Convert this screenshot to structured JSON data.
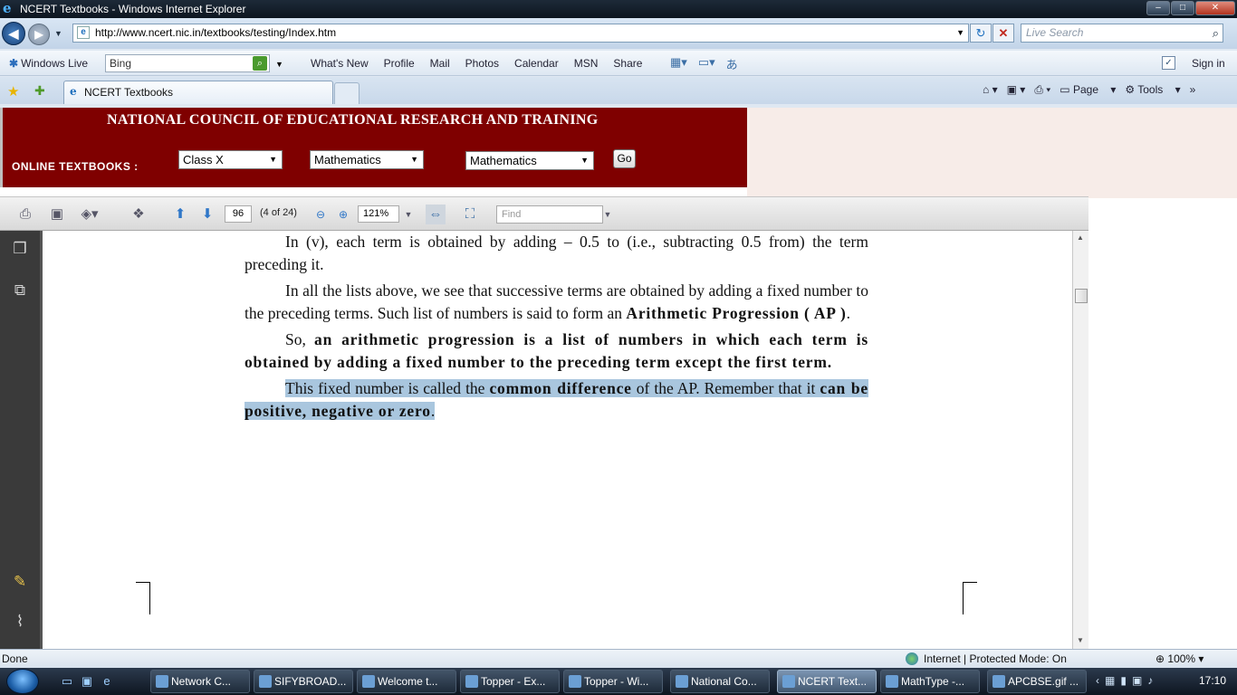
{
  "window": {
    "title": "NCERT Textbooks - Windows Internet Explorer",
    "min": "‒",
    "max": "□",
    "close": "✕"
  },
  "addressbar": {
    "url": "http://www.ncert.nic.in/textbooks/testing/Index.htm",
    "live_search_placeholder": "Live Search"
  },
  "live_toolbar": {
    "brand": "Windows Live",
    "search_value": "Bing",
    "links": [
      "What's New",
      "Profile",
      "Mail",
      "Photos",
      "Calendar",
      "MSN",
      "Share"
    ],
    "sign_in": "Sign in"
  },
  "tabs": {
    "active_tab": "NCERT Textbooks"
  },
  "command_bar": {
    "page": "Page",
    "tools": "Tools"
  },
  "ncert": {
    "title": "NATIONAL COUNCIL OF EDUCATIONAL RESEARCH AND TRAINING",
    "online_label": "ONLINE  TEXTBOOKS :",
    "class_select": "Class X",
    "subject_select": "Mathematics",
    "book_select": "Mathematics",
    "go_button": "Go"
  },
  "pdf_viewer": {
    "page_number": "96",
    "page_of": "(4 of 24)",
    "zoom": "121%",
    "find_placeholder": "Find"
  },
  "pdf_content": {
    "p1": "In (v), each term is obtained by adding – 0.5 to (i.e., subtracting 0.5 from) the term preceding it.",
    "p2_a": "In all the lists above, we see that successive terms are obtained by adding a fixed number to the preceding terms. Such list of numbers is said to form an ",
    "p2_b": "Arithmetic Progression ( AP )",
    "p2_c": ".",
    "p3_a": "So, ",
    "p3_b": "an arithmetic progression is a list of numbers in which each term  is obtained by adding a fixed number to the preceding term except the first term.",
    "p4_a": "This fixed number is called the ",
    "p4_b": "common difference",
    "p4_c": " of the AP. Remember that it ",
    "p4_d": "can be positive, negative or zero",
    "p4_e": "."
  },
  "statusbar": {
    "status": "Done",
    "zone": "Internet | Protected Mode: On",
    "zoom": "100%"
  },
  "taskbar": {
    "tasks": [
      "Network C...",
      "SIFYBROAD...",
      "Welcome t...",
      "Topper - Ex...",
      "Topper - Wi...",
      "National Co...",
      "NCERT Text...",
      "MathType -...",
      "APCBSE.gif ..."
    ],
    "clock": "17:10"
  }
}
